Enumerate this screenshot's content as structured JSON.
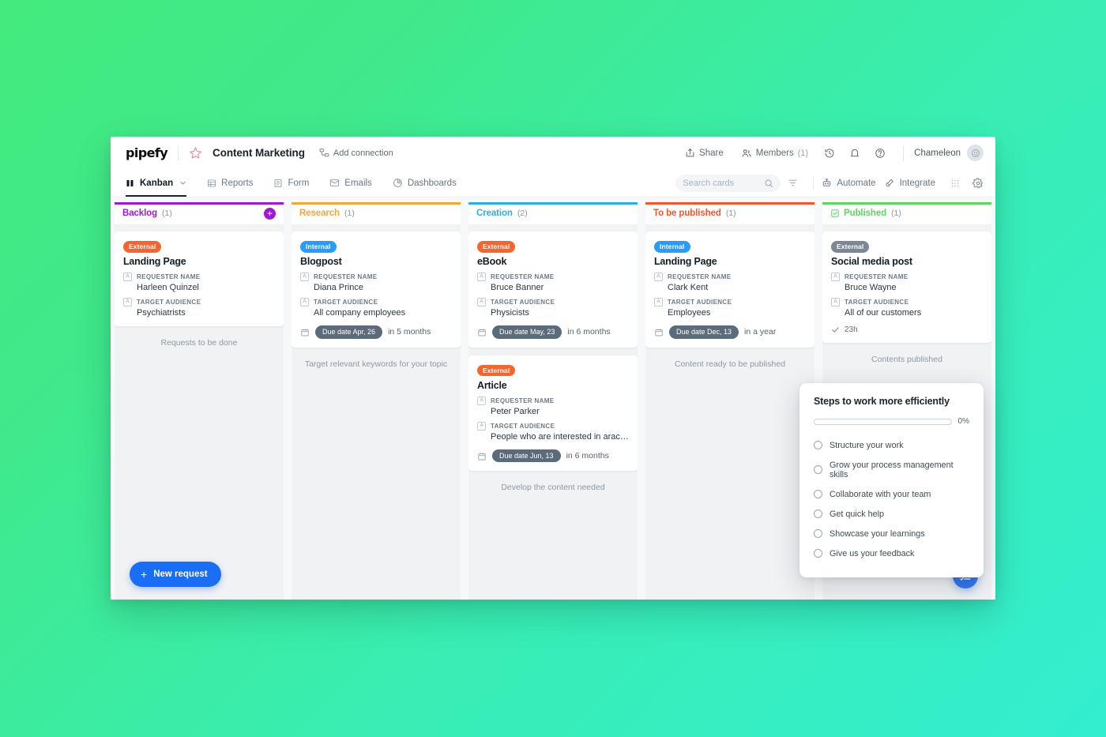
{
  "brand": {
    "logo_text": "pipefy",
    "accent_blue": "#1a6ef5"
  },
  "topbar": {
    "pipe_title": "Content Marketing",
    "add_connection": "Add connection",
    "share": "Share",
    "members": "Members",
    "members_count": "(1)",
    "user_name": "Chameleon",
    "icons": {
      "star": "star-icon",
      "connection": "connection-icon",
      "share": "share-icon",
      "members": "members-icon",
      "history": "history-icon",
      "bell": "bell-icon",
      "help": "help-icon",
      "avatar": "avatar-icon"
    }
  },
  "navbar": {
    "items": [
      {
        "label": "Kanban",
        "icon": "kanban-icon",
        "active": true,
        "has_caret": true
      },
      {
        "label": "Reports",
        "icon": "reports-icon",
        "active": false
      },
      {
        "label": "Form",
        "icon": "form-icon",
        "active": false
      },
      {
        "label": "Emails",
        "icon": "emails-icon",
        "active": false
      },
      {
        "label": "Dashboards",
        "icon": "dashboards-icon",
        "active": false
      }
    ],
    "search_placeholder": "Search cards",
    "search_value": "",
    "automate": "Automate",
    "integrate": "Integrate"
  },
  "board": {
    "columns": [
      {
        "name": "Backlog",
        "count": "(1)",
        "color": "#a017d6",
        "has_add": true,
        "has_check": false,
        "hint": "Requests to be done",
        "cards": [
          {
            "badge": "External",
            "badge_type": "external",
            "title": "Landing Page",
            "fields": [
              {
                "label": "REQUESTER NAME",
                "value": "Harleen Quinzel"
              },
              {
                "label": "TARGET AUDIENCE",
                "value": "Psychiatrists"
              }
            ]
          }
        ]
      },
      {
        "name": "Research",
        "count": "(1)",
        "color": "#f2a63b",
        "has_add": false,
        "has_check": false,
        "hint": "Target relevant keywords for your topic",
        "cards": [
          {
            "badge": "Internal",
            "badge_type": "internal",
            "title": "Blogpost",
            "fields": [
              {
                "label": "REQUESTER NAME",
                "value": "Diana Prince"
              },
              {
                "label": "TARGET AUDIENCE",
                "value": "All company employees"
              }
            ],
            "due_pill": "Due date Apr, 26",
            "due_relative": "in 5 months"
          }
        ]
      },
      {
        "name": "Creation",
        "count": "(2)",
        "color": "#2ab0e0",
        "has_add": false,
        "has_check": false,
        "hint": "Develop the content needed",
        "cards": [
          {
            "badge": "External",
            "badge_type": "external",
            "title": "eBook",
            "fields": [
              {
                "label": "REQUESTER NAME",
                "value": "Bruce Banner"
              },
              {
                "label": "TARGET AUDIENCE",
                "value": "Physicists"
              }
            ],
            "due_pill": "Due date May, 23",
            "due_relative": "in 6 months"
          },
          {
            "badge": "External",
            "badge_type": "external",
            "title": "Article",
            "fields": [
              {
                "label": "REQUESTER NAME",
                "value": "Peter Parker"
              },
              {
                "label": "TARGET AUDIENCE",
                "value": "People who are interested in arach..."
              }
            ],
            "due_pill": "Due date Jun, 13",
            "due_relative": "in 6 months"
          }
        ]
      },
      {
        "name": "To be published",
        "count": "(1)",
        "color": "#f4542a",
        "has_add": false,
        "has_check": false,
        "hint": "Content ready to be published",
        "cards": [
          {
            "badge": "Internal",
            "badge_type": "internal",
            "title": "Landing Page",
            "fields": [
              {
                "label": "REQUESTER NAME",
                "value": "Clark Kent"
              },
              {
                "label": "TARGET AUDIENCE",
                "value": "Employees"
              }
            ],
            "due_pill": "Due date Dec, 13",
            "due_relative": "in a year"
          }
        ]
      },
      {
        "name": "Published",
        "count": "(1)",
        "color": "#5fd35f",
        "has_add": false,
        "has_check": true,
        "hint": "Contents published",
        "cards": [
          {
            "badge": "External",
            "badge_type": "muted",
            "title": "Social media post",
            "fields": [
              {
                "label": "REQUESTER NAME",
                "value": "Bruce Wayne"
              },
              {
                "label": "TARGET AUDIENCE",
                "value": "All of our customers"
              }
            ],
            "done_time": "23h"
          }
        ]
      }
    ],
    "new_request": "New request"
  },
  "checklist": {
    "title": "Steps to work more efficiently",
    "percent": "0%",
    "progress_value": 0,
    "items": [
      {
        "label": "Structure your work",
        "checked": false
      },
      {
        "label": "Grow your process management skills",
        "checked": false
      },
      {
        "label": "Collaborate with your team",
        "checked": false
      },
      {
        "label": "Get quick help",
        "checked": false
      },
      {
        "label": "Showcase your learnings",
        "checked": false
      },
      {
        "label": "Give us your feedback",
        "checked": false
      }
    ]
  }
}
